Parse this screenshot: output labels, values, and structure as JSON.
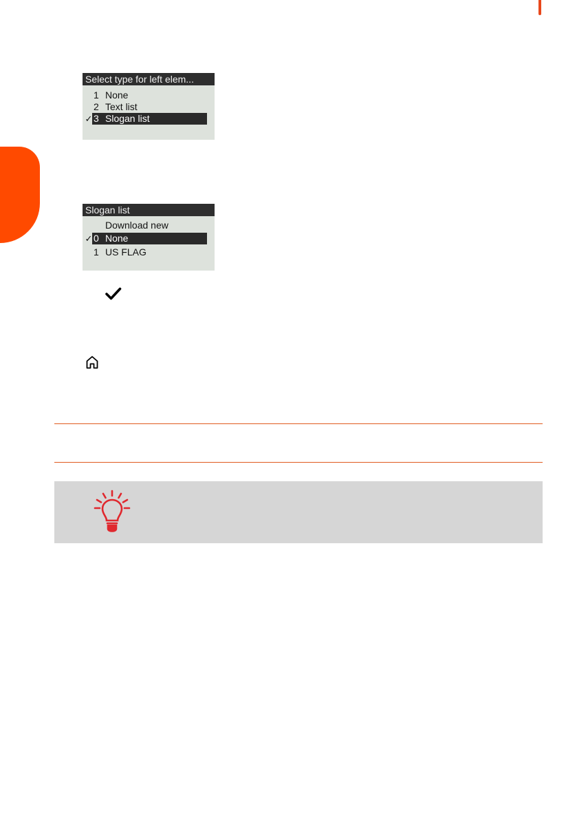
{
  "colors": {
    "accent": "#ff4a00",
    "rule": "#e05a1e",
    "lcd_background": "#dde2dc",
    "lcd_header": "#2e2e2e",
    "tip_background": "#d6d6d6",
    "bulb_red": "#e0282e"
  },
  "screen_type_select": {
    "title": "Select type for left elem...",
    "items": [
      {
        "check": "",
        "number": "1",
        "label": "None"
      },
      {
        "check": "",
        "number": "2",
        "label": "Text list"
      },
      {
        "check": "✓",
        "number": "3",
        "label": "Slogan list"
      }
    ],
    "selected_index": 2
  },
  "screen_slogan_list": {
    "title": "Slogan list",
    "items": [
      {
        "check": "",
        "number": "",
        "label": "Download new"
      },
      {
        "check": "✓",
        "number": "0",
        "label": "None"
      },
      {
        "check": "",
        "number": "1",
        "label": "US FLAG"
      }
    ],
    "selected_index": 1
  },
  "icons": {
    "ok_key": "check-icon",
    "home_key": "home-icon",
    "tip": "lightbulb-icon"
  }
}
